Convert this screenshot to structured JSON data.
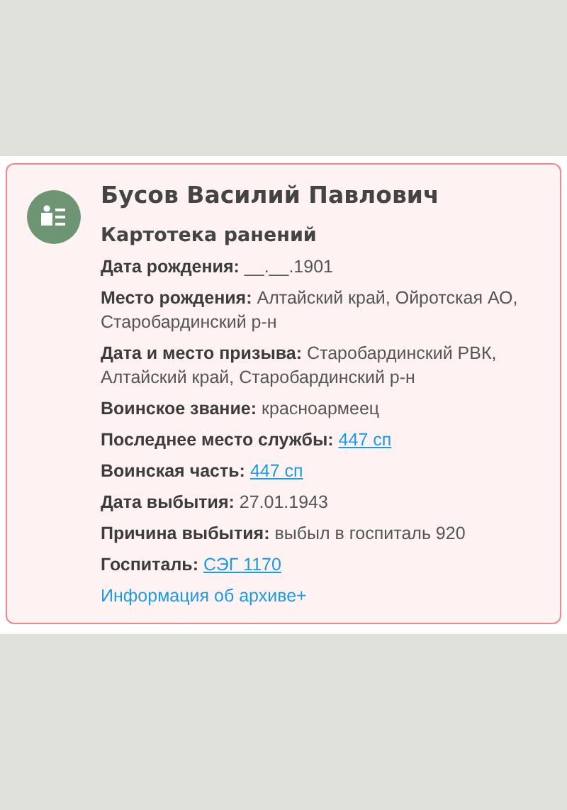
{
  "card": {
    "name": "Бусов Василий Павлович",
    "source": "Картотека ранений",
    "fields": [
      {
        "kind": "text",
        "text": "**Дата рождения:** __.__.1901"
      },
      {
        "kind": "text",
        "text": "**Место рождения:** Алтайский край, Ойротская АО, Старобардинский р-н"
      },
      {
        "kind": "text",
        "text": "**Дата и место призыва:** Старобардинский РВК, Алтайский край, Старобардинский р-н"
      },
      {
        "kind": "text",
        "text": "**Воинское звание:** красноармеец"
      },
      {
        "kind": "link",
        "label": "Последнее место службы:",
        "value": "447 сп"
      },
      {
        "kind": "link",
        "label": "Воинская часть:",
        "value": "447 сп"
      },
      {
        "kind": "text",
        "text": "**Дата выбытия:** 27.01.1943"
      },
      {
        "kind": "text",
        "text": "**Причина выбытия:** выбыл в госпиталь 920"
      },
      {
        "kind": "link",
        "label": "Госпиталь:",
        "value": "СЭГ 1170"
      }
    ],
    "archive_link": "Информация об архиве+"
  }
}
